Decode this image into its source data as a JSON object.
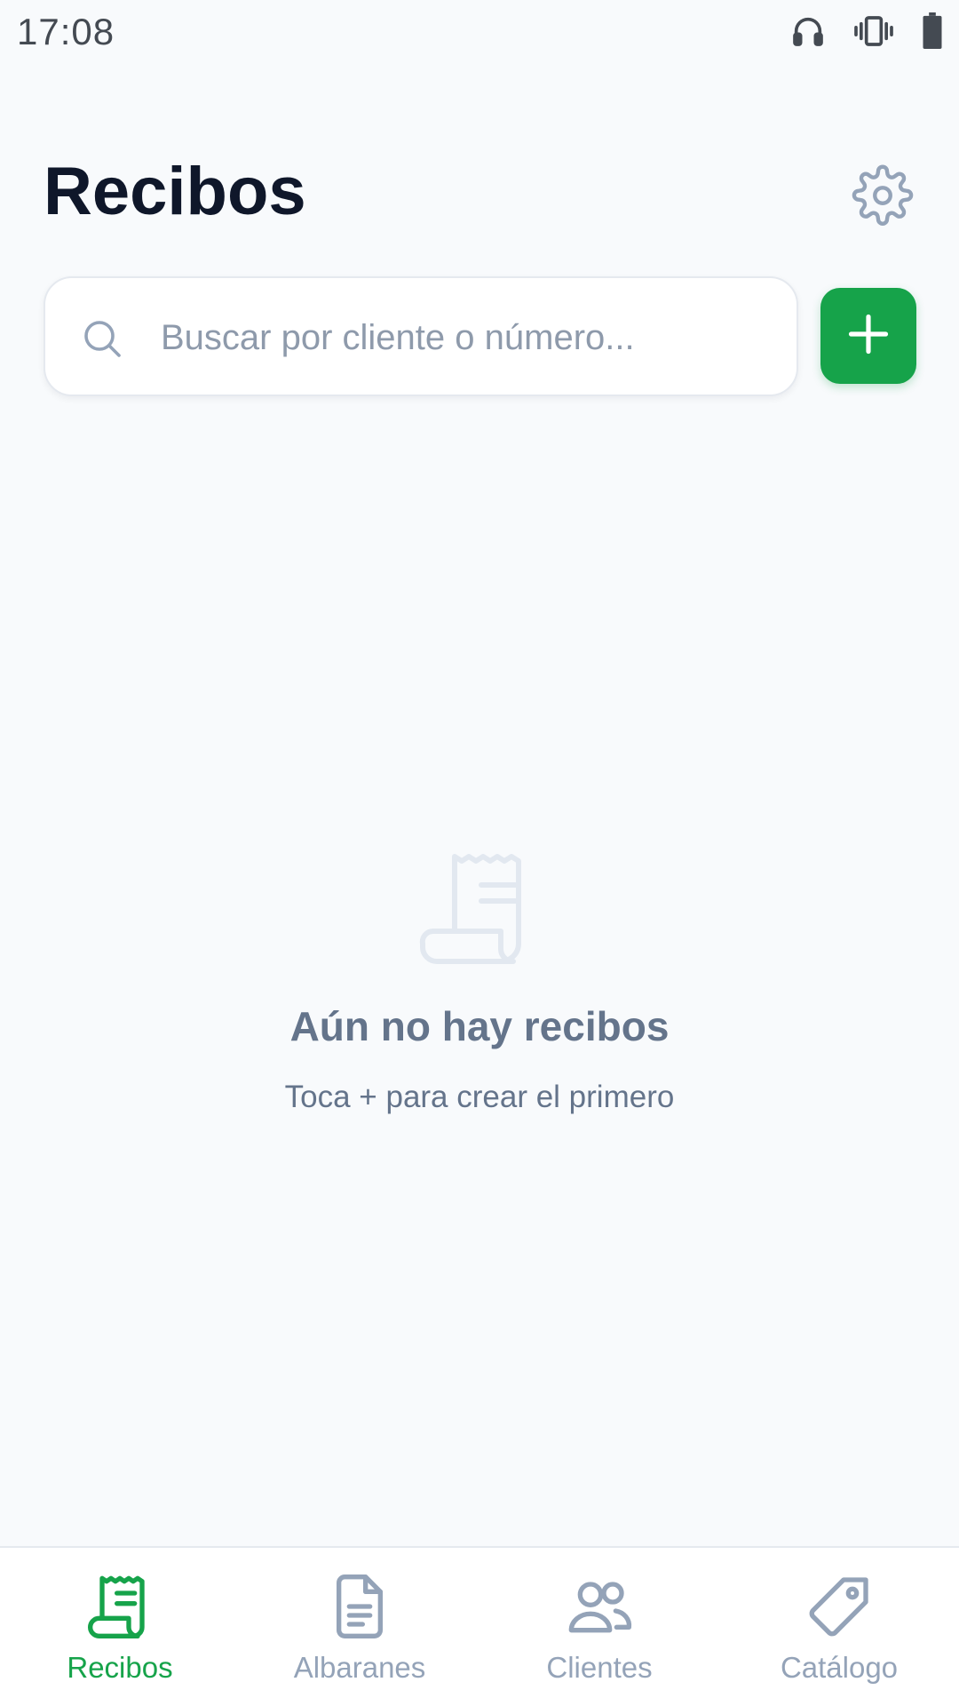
{
  "status_bar": {
    "time": "17:08"
  },
  "header": {
    "title": "Recibos"
  },
  "search": {
    "placeholder": "Buscar por cliente o número...",
    "value": ""
  },
  "empty_state": {
    "title": "Aún no hay recibos",
    "subtitle": "Toca + para crear el primero"
  },
  "bottom_nav": {
    "items": [
      {
        "label": "Recibos",
        "icon": "receipt-icon",
        "active": true
      },
      {
        "label": "Albaranes",
        "icon": "document-icon",
        "active": false
      },
      {
        "label": "Clientes",
        "icon": "users-icon",
        "active": false
      },
      {
        "label": "Catálogo",
        "icon": "tag-icon",
        "active": false
      }
    ]
  },
  "colors": {
    "accent": "#16a34a",
    "background": "#f8fafc",
    "title": "#0f172a",
    "muted": "#64748b",
    "inactive": "#94a3b8"
  }
}
